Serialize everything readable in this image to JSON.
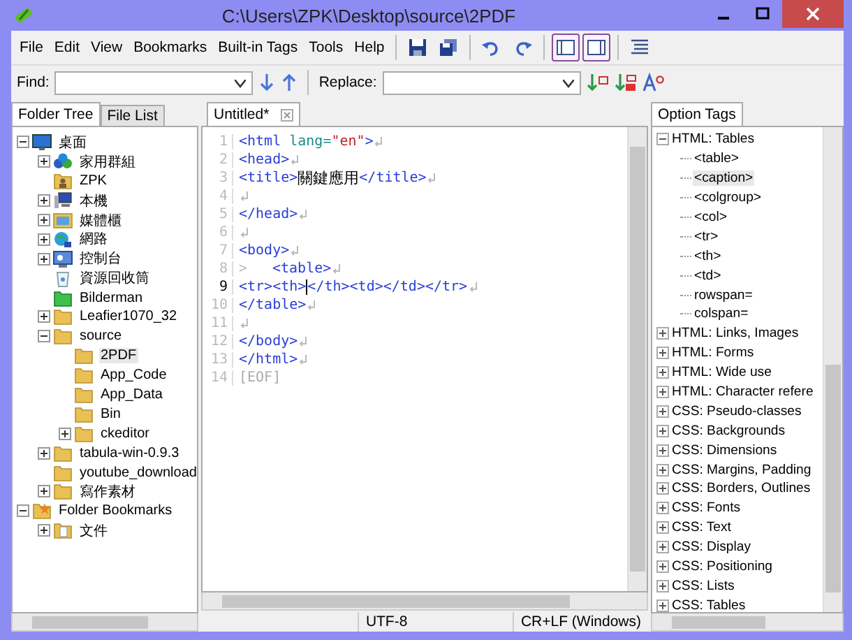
{
  "window": {
    "title": "C:\\Users\\ZPK\\Desktop\\source\\2PDF"
  },
  "menu": [
    "File",
    "Edit",
    "View",
    "Bookmarks",
    "Built-in Tags",
    "Tools",
    "Help"
  ],
  "toolbar": [
    {
      "kind": "save",
      "selected": false
    },
    {
      "kind": "save-all",
      "selected": false
    },
    {
      "kind": "undo",
      "selected": false
    },
    {
      "kind": "redo",
      "selected": false
    },
    {
      "kind": "left-pane",
      "selected": true
    },
    {
      "kind": "right-pane",
      "selected": true
    },
    {
      "kind": "align",
      "selected": false
    }
  ],
  "find": {
    "label": "Find:"
  },
  "replace": {
    "label": "Replace:"
  },
  "left_tabs": [
    {
      "label": "Folder Tree",
      "selected": true
    },
    {
      "label": "File List",
      "selected": false
    }
  ],
  "folder_tree": [
    {
      "label": "桌面",
      "kind": "desktop",
      "expanded": true,
      "selected": false,
      "children": [
        {
          "label": "家用群組",
          "kind": "homegroup",
          "expanded": false,
          "selected": false
        },
        {
          "label": "ZPK",
          "kind": "user",
          "selected": false
        },
        {
          "label": "本機",
          "kind": "computer",
          "expanded": false,
          "selected": false
        },
        {
          "label": "媒體櫃",
          "kind": "library",
          "expanded": false,
          "selected": false
        },
        {
          "label": "網路",
          "kind": "network",
          "expanded": false,
          "selected": false
        },
        {
          "label": "控制台",
          "kind": "control-panel",
          "expanded": false,
          "selected": false
        },
        {
          "label": "資源回收筒",
          "kind": "recycle-bin",
          "selected": false
        },
        {
          "label": "Bilderman",
          "kind": "green-folder",
          "selected": false
        },
        {
          "label": "Leafier1070_32",
          "kind": "folder",
          "expanded": false,
          "selected": false
        },
        {
          "label": "source",
          "kind": "folder",
          "expanded": true,
          "selected": false,
          "children": [
            {
              "label": "2PDF",
              "kind": "folder",
              "selected": true
            },
            {
              "label": "App_Code",
              "kind": "folder",
              "selected": false
            },
            {
              "label": "App_Data",
              "kind": "folder",
              "selected": false
            },
            {
              "label": "Bin",
              "kind": "folder",
              "selected": false
            },
            {
              "label": "ckeditor",
              "kind": "folder",
              "expanded": false,
              "selected": false
            }
          ]
        },
        {
          "label": "tabula-win-0.9.3",
          "kind": "folder",
          "expanded": false,
          "selected": false
        },
        {
          "label": "youtube_download",
          "kind": "folder",
          "selected": false
        },
        {
          "label": "寫作素材",
          "kind": "folder",
          "expanded": false,
          "selected": false
        }
      ]
    },
    {
      "label": "Folder Bookmarks",
      "kind": "bookmarks",
      "expanded": true,
      "selected": false,
      "children": [
        {
          "label": "文件",
          "kind": "document-folder",
          "expanded": false,
          "selected": false
        }
      ]
    }
  ],
  "editor_tab": {
    "label": "Untitled*"
  },
  "code_lines": [
    {
      "number": "1",
      "current": false,
      "eol": true,
      "segments": [
        {
          "kind": "tag",
          "text": "<html "
        },
        {
          "kind": "attr",
          "text": "lang="
        },
        {
          "kind": "value",
          "text": "\"en\""
        },
        {
          "kind": "tag",
          "text": ">"
        }
      ]
    },
    {
      "number": "2",
      "current": false,
      "eol": true,
      "segments": [
        {
          "kind": "tag",
          "text": "<head>"
        }
      ]
    },
    {
      "number": "3",
      "current": false,
      "eol": true,
      "segments": [
        {
          "kind": "tag",
          "text": "<title>"
        },
        {
          "kind": "text",
          "text": "關鍵應用"
        },
        {
          "kind": "tag",
          "text": "</title>"
        }
      ]
    },
    {
      "number": "4",
      "current": false,
      "eol": true
    },
    {
      "number": "5",
      "current": false,
      "eol": true,
      "segments": [
        {
          "kind": "tag",
          "text": "</head>"
        }
      ]
    },
    {
      "number": "6",
      "current": false,
      "eol": true
    },
    {
      "number": "7",
      "current": false,
      "eol": true,
      "segments": [
        {
          "kind": "tag",
          "text": "<body>"
        }
      ]
    },
    {
      "number": "8",
      "current": false,
      "eol": true,
      "segments": [
        {
          "kind": "tab",
          "text": ">"
        },
        {
          "kind": "tag",
          "text": "<table>"
        }
      ]
    },
    {
      "number": "9",
      "current": true,
      "eol": true,
      "segments": [
        {
          "kind": "tag",
          "text": "<tr><th>"
        },
        {
          "kind": "caret"
        },
        {
          "kind": "tag",
          "text": "</th><td></td></tr>"
        }
      ]
    },
    {
      "number": "10",
      "current": false,
      "eol": true,
      "segments": [
        {
          "kind": "tag",
          "text": "</table>"
        }
      ]
    },
    {
      "number": "11",
      "current": false,
      "eol": true
    },
    {
      "number": "12",
      "current": false,
      "eol": true,
      "segments": [
        {
          "kind": "tag",
          "text": "</body>"
        }
      ]
    },
    {
      "number": "13",
      "current": false,
      "eol": true,
      "segments": [
        {
          "kind": "tag",
          "text": "</html>"
        }
      ]
    },
    {
      "number": "14",
      "current": false,
      "segments": [
        {
          "kind": "eof",
          "text": "[EOF]"
        }
      ]
    }
  ],
  "right_tabs": [
    {
      "label": "Option Tags",
      "selected": true
    }
  ],
  "option_tags": [
    {
      "label": "HTML: Tables",
      "expanded": true,
      "selected": false,
      "children": [
        {
          "label": "<table>",
          "selected": false
        },
        {
          "label": "<caption>",
          "selected": true
        },
        {
          "label": "<colgroup>",
          "selected": false
        },
        {
          "label": "<col>",
          "selected": false
        },
        {
          "label": "<tr>",
          "selected": false
        },
        {
          "label": "<th>",
          "selected": false
        },
        {
          "label": "<td>",
          "selected": false
        },
        {
          "label": "rowspan=",
          "selected": false
        },
        {
          "label": "colspan=",
          "selected": false
        }
      ]
    },
    {
      "label": "HTML: Links, Images",
      "expanded": false,
      "selected": false
    },
    {
      "label": "HTML: Forms",
      "expanded": false,
      "selected": false
    },
    {
      "label": "HTML: Wide use",
      "expanded": false,
      "selected": false
    },
    {
      "label": "HTML: Character refere",
      "expanded": false,
      "selected": false
    },
    {
      "label": "CSS: Pseudo-classes",
      "expanded": false,
      "selected": false
    },
    {
      "label": "CSS: Backgrounds",
      "expanded": false,
      "selected": false
    },
    {
      "label": "CSS: Dimensions",
      "expanded": false,
      "selected": false
    },
    {
      "label": "CSS: Margins, Padding",
      "expanded": false,
      "selected": false
    },
    {
      "label": "CSS: Borders, Outlines",
      "expanded": false,
      "selected": false
    },
    {
      "label": "CSS: Fonts",
      "expanded": false,
      "selected": false
    },
    {
      "label": "CSS: Text",
      "expanded": false,
      "selected": false
    },
    {
      "label": "CSS: Display",
      "expanded": false,
      "selected": false
    },
    {
      "label": "CSS: Positioning",
      "expanded": false,
      "selected": false
    },
    {
      "label": "CSS: Lists",
      "expanded": false,
      "selected": false
    },
    {
      "label": "CSS: Tables",
      "expanded": false,
      "selected": false
    }
  ],
  "status_bar": [
    "UTF-8",
    "CR+LF (Windows)"
  ]
}
